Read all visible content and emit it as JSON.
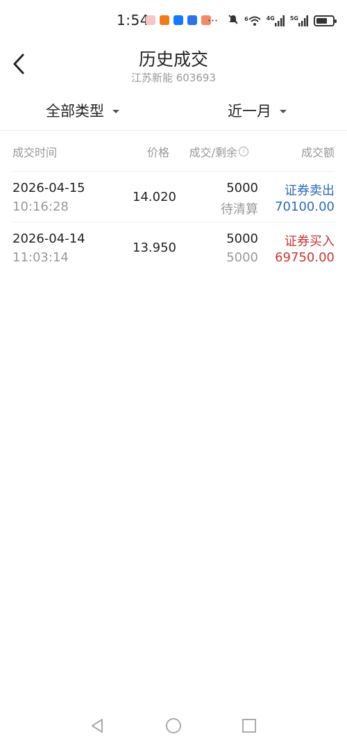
{
  "status_bar": {
    "time": "1:54",
    "app_icons": [
      {
        "name": "mail-app-icon",
        "color": "#e8a0a0"
      },
      {
        "name": "taobao-app-icon",
        "color": "#f07b1a"
      },
      {
        "name": "alipay-app-icon",
        "color": "#1677ff"
      },
      {
        "name": "browser-app-icon",
        "color": "#2a73e8"
      },
      {
        "name": "reader-app-icon",
        "color": "#f08b6a"
      }
    ],
    "overflow": "···",
    "signal_labels": [
      "6",
      "4G",
      "5G"
    ],
    "battery_level": 0.7
  },
  "header": {
    "title": "历史成交",
    "subtitle": "江苏新能 603693"
  },
  "filters": {
    "type_label": "全部类型",
    "period_label": "近一月"
  },
  "table": {
    "columns": {
      "time": "成交时间",
      "price": "价格",
      "volume": "成交/剩余",
      "amount": "成交额"
    },
    "rows": [
      {
        "date": "2026-04-15",
        "clock": "10:16:28",
        "price": "14.020",
        "volume": "5000",
        "remain": "待清算",
        "type": "证券卖出",
        "amount": "70100.00",
        "side": "sell"
      },
      {
        "date": "2026-04-14",
        "clock": "11:03:14",
        "price": "13.950",
        "volume": "5000",
        "remain": "5000",
        "type": "证券买入",
        "amount": "69750.00",
        "side": "buy"
      }
    ]
  },
  "colors": {
    "sell": "#2e6ab8",
    "buy": "#c93532",
    "muted": "#999999"
  }
}
